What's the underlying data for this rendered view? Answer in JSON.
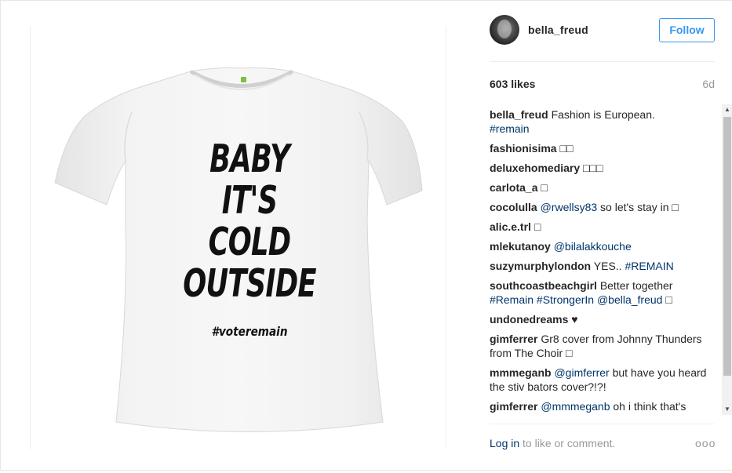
{
  "post": {
    "image": {
      "alt": "",
      "shirt_lines": [
        "BABY",
        "IT'S",
        "COLD",
        "OUTSIDE"
      ],
      "shirt_hashtag": "#voteremain",
      "shirt_color": "#f2f2f2",
      "label_color": "#7bc043"
    },
    "header": {
      "username": "bella_freud",
      "follow_label": "Follow"
    },
    "likes": "603 likes",
    "age": "6d",
    "caption": {
      "user": "bella_freud",
      "text": "Fashion is European.",
      "tag": "#remain"
    },
    "comments": [
      {
        "user": "fashionisima",
        "text": "□□"
      },
      {
        "user": "deluxehomediary",
        "text": "□□□"
      },
      {
        "user": "carlota_a",
        "text": "□"
      },
      {
        "user": "cocolulla",
        "mention": "@rwellsy83",
        "text": "so let's stay in □"
      },
      {
        "user": "alic.e.trl",
        "text": "□"
      },
      {
        "user": "mlekutanoy",
        "mention": "@bilalakkouche",
        "text": ""
      },
      {
        "user": "suzymurphylondon",
        "text": "YES..",
        "tag": "#REMAIN"
      },
      {
        "user": "southcoastbeachgirl",
        "text": "Better together",
        "tags_line": "#Remain #StrongerIn @bella_freud",
        "suffix": "□"
      },
      {
        "user": "undonedreams",
        "text": "♥"
      },
      {
        "user": "gimferrer",
        "text": "Gr8 cover from Johnny Thunders from The Choir □"
      },
      {
        "user": "mmmeganb",
        "mention": "@gimferrer",
        "text": "but have you heard the stiv bators cover?!?!"
      },
      {
        "user": "gimferrer",
        "mention": "@mmmeganb",
        "text": "oh i think that's"
      }
    ],
    "footer": {
      "login_label": "Log in",
      "rest_label": "to like or comment.",
      "more_icon": "ooo"
    },
    "colors": {
      "accent": "#3897f0",
      "link": "#003569",
      "muted": "#999999"
    }
  }
}
